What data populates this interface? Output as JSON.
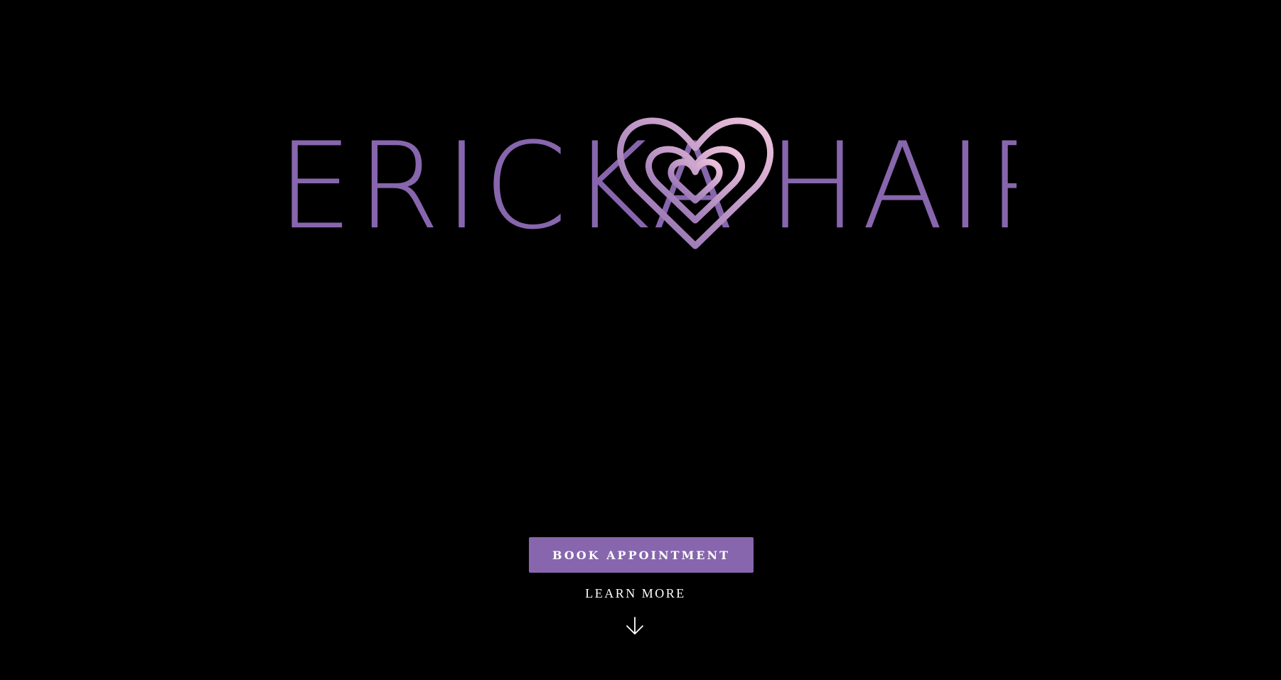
{
  "brand": {
    "logo_left": "ERICKA",
    "logo_right": "HAIR",
    "colors": {
      "purple": "#8766ad",
      "pink": "#e6b8d6"
    }
  },
  "hero": {
    "book_label": "BOOK APPOINTMENT",
    "learn_more_label": "LEARN MORE",
    "scroll_icon": "arrow-down-icon"
  },
  "colors": {
    "background": "#000000",
    "button": "#8766ad",
    "text": "#ffffff"
  }
}
